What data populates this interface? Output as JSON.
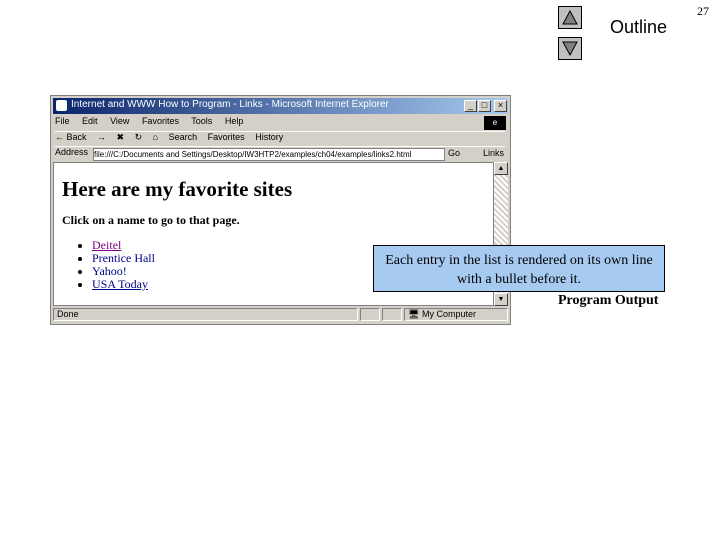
{
  "slide": {
    "number": "27",
    "outline_label": "Outline",
    "program_output_label": "Program Output"
  },
  "callout": {
    "text": "Each entry in the list is rendered on its own line with a bullet before it."
  },
  "browser": {
    "title": "Internet and WWW How to Program - Links - Microsoft Internet Explorer",
    "menu": [
      "File",
      "Edit",
      "View",
      "Favorites",
      "Tools",
      "Help"
    ],
    "toolbar": [
      "← Back",
      "→",
      "✖",
      "↻",
      "⌂",
      "Search",
      "Favorites",
      "History"
    ],
    "address_label": "Address",
    "address_value": "file:///C:/Documents and Settings/Desktop/IW3HTP2/examples/ch04/examples/links2.html",
    "go_label": "Go",
    "links_label": "Links »",
    "status_left": "Done",
    "status_right": "My Computer"
  },
  "page": {
    "heading": "Here are my favorite sites",
    "instruction": "Click on a name to go to that page.",
    "links": [
      {
        "text": "Deitel",
        "style": "visited"
      },
      {
        "text": "Prentice Hall",
        "style": "plain"
      },
      {
        "text": "Yahoo!",
        "style": "plain"
      },
      {
        "text": "USA Today",
        "style": "link"
      }
    ]
  }
}
